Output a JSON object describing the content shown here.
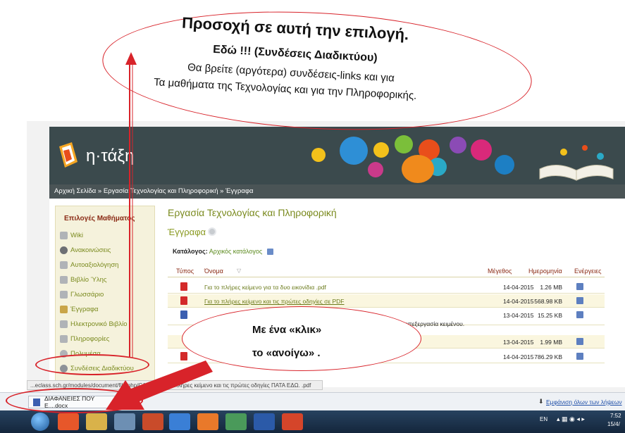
{
  "annotation_top": {
    "title": "Προσοχή σε αυτή την επιλογή.",
    "subtitle": "Εδώ !!! (Συνδέσεις Διαδικτύου)",
    "line1": "Θα βρείτε (αργότερα) συνδέσεις-links και για",
    "line2": "Τα μαθήματα της Τεχνολογίας και για την Πληροφορικής."
  },
  "annotation_mid": {
    "line1": "Με ένα «κλικ»",
    "line2": "το «ανοίγω» ."
  },
  "site": {
    "logo": "η·τάξη",
    "breadcrumb": "Αρχική Σελίδα » Εργασία Τεχνολογίας και Πληροφορική » Έγγραφα",
    "course_title": "Εργασία Τεχνολογίας και Πληροφορική",
    "section_title": "Έγγραφα",
    "catalog_label": "Κατάλογος:",
    "catalog_value": "Αρχικός κατάλογος"
  },
  "sidebar": {
    "heading": "Επιλογές Μαθήματος",
    "items": [
      "Wiki",
      "Ανακοινώσεις",
      "Αυτοαξιολόγηση",
      "Βιβλίο Ύλης",
      "Γλωσσάριο",
      "Έγγραφα",
      "Ηλεκτρονικό Βιβλίο",
      "Πληροφορίες",
      "Πολυμέσα",
      "Συνδέσεις Διαδικτύου"
    ]
  },
  "table": {
    "headers": {
      "type": "Τύπος",
      "name": "Όνομα",
      "size": "Μέγεθος",
      "date": "Ημερομηνία",
      "actions": "Ενέργειες"
    },
    "rows": [
      {
        "type": "pdf",
        "name": "Για το πλήρες κείμενο για τα δυο εικονίδια .pdf",
        "size": "1.26 MB",
        "date": "14-04-2015"
      },
      {
        "type": "pdf",
        "name": "Για το πλήρες κείμενο και τις πρώτες οδηγίες σε PDF",
        "size": "568.98 KB",
        "date": "14-04-2015"
      },
      {
        "type": "doc",
        "name": "...επεξεργασία κειμένου.",
        "size": "15.25 KB",
        "date": "13-04-2015"
      },
      {
        "type": "doc",
        "name": "",
        "size": "1.99 MB",
        "date": "13-04-2015"
      },
      {
        "type": "pdf",
        "name": "",
        "size": "786.29 KB",
        "date": "14-04-2015"
      }
    ]
  },
  "statusbar": {
    "text": "...eclass.sch.gr/modules/document/file.php/G100...   Για το πλήρες κείμενο και τις πρώτες οδηγίες ΠΑΤΑ ΕΔΩ. .pdf"
  },
  "downloads": {
    "item": "ΔΙΑΦΑΝΕΙΕΣ ΠΟΥ Ε....docx",
    "show_all": "Εμφάνιση όλων των λήψεων"
  },
  "taskbar": {
    "lang": "EN",
    "time": "7:52",
    "date": "15/4/"
  },
  "colors": {
    "accent_green": "#7a8a1e",
    "banner": "#3b4a4d",
    "annotation_red": "#d8232a"
  }
}
